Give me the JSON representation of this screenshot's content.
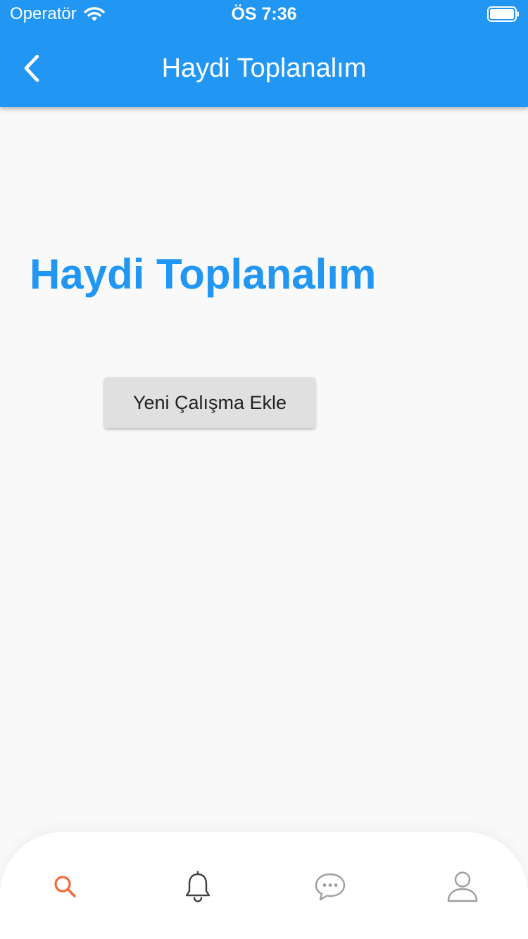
{
  "status_bar": {
    "carrier": "Operatör",
    "time": "ÖS 7:36"
  },
  "header": {
    "title": "Haydi Toplanalım",
    "back_icon": "chevron-left-icon"
  },
  "main": {
    "heading": "Haydi Toplanalım",
    "add_button_label": "Yeni Çalışma Ekle"
  },
  "bottom_nav": {
    "items": [
      {
        "icon": "search-icon",
        "active": true
      },
      {
        "icon": "bell-icon",
        "active": false
      },
      {
        "icon": "chat-icon",
        "active": false
      },
      {
        "icon": "user-icon",
        "active": false
      }
    ]
  },
  "colors": {
    "primary": "#2196f3",
    "active_nav": "#f26b3a",
    "inactive_nav": "#9e9e9e",
    "background": "#f9f9f9",
    "button_bg": "#e0e0e0"
  }
}
